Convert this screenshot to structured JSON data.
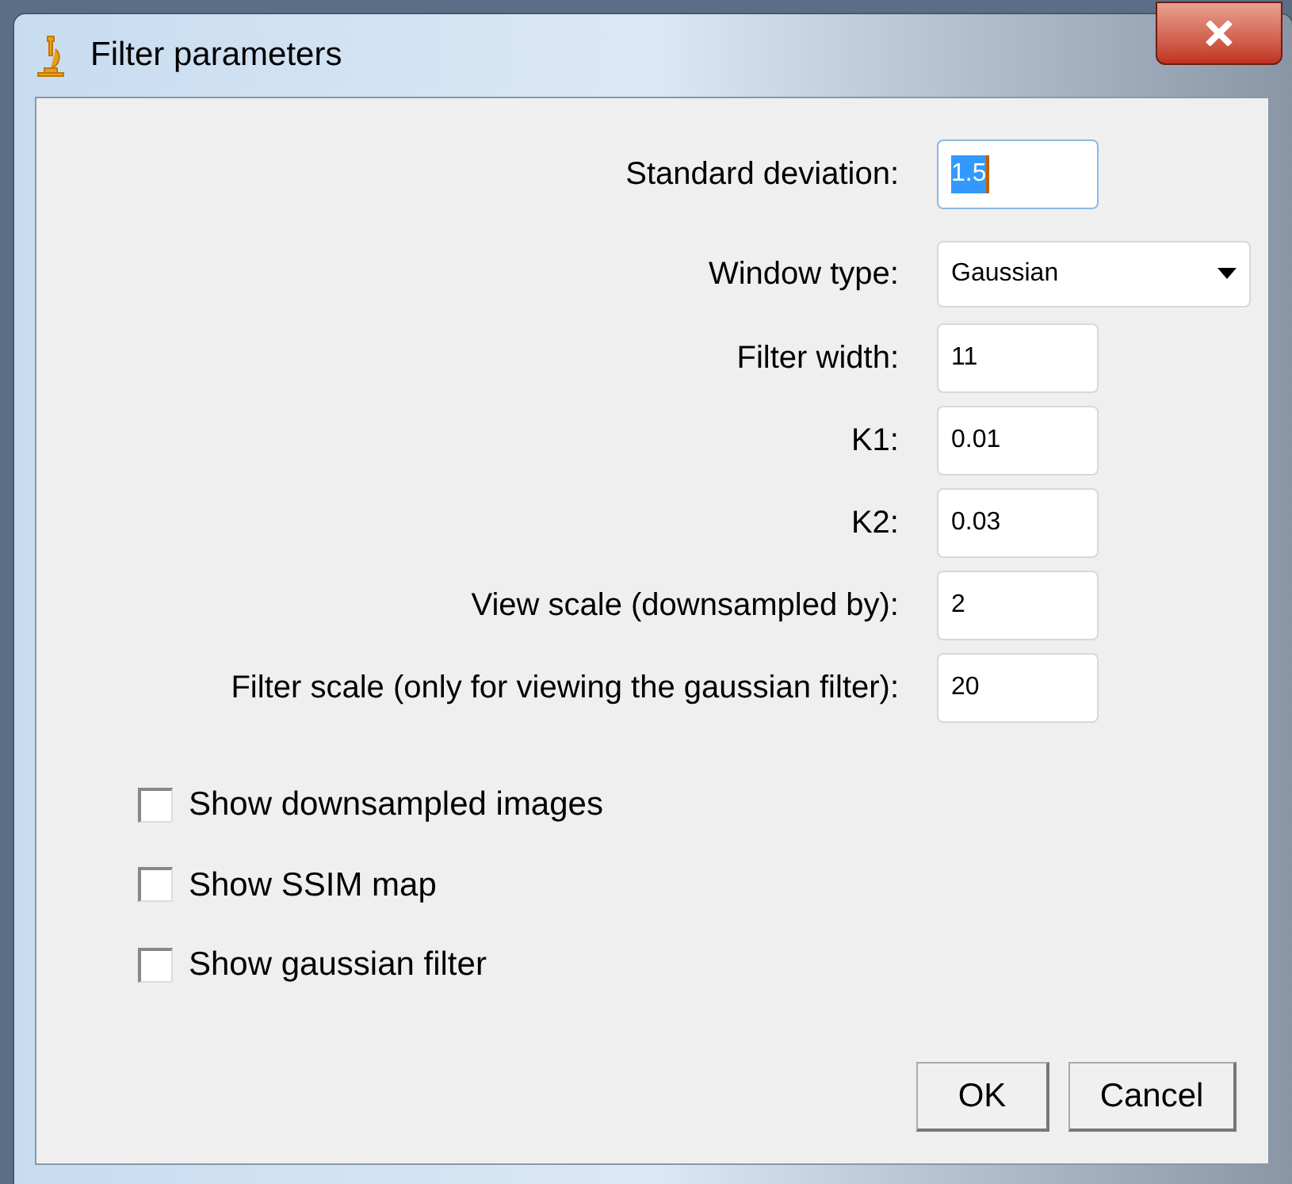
{
  "window": {
    "title": "Filter parameters"
  },
  "fields": [
    {
      "kind": "text",
      "label": "Standard deviation:",
      "value": "1.5",
      "highlighted": true
    },
    {
      "kind": "dropdown",
      "label": "Window type:",
      "value": "Gaussian",
      "highlighted": false
    },
    {
      "kind": "text",
      "label": "Filter width:",
      "value": "11",
      "highlighted": false
    },
    {
      "kind": "text",
      "label": "K1:",
      "value": "0.01",
      "highlighted": false
    },
    {
      "kind": "text",
      "label": "K2:",
      "value": "0.03",
      "highlighted": false
    },
    {
      "kind": "text",
      "label": "View scale (downsampled by):",
      "value": "2",
      "highlighted": false
    },
    {
      "kind": "text",
      "label": "Filter scale (only for viewing the gaussian filter):",
      "value": "20",
      "highlighted": false
    }
  ],
  "checkboxes": [
    {
      "label": "Show downsampled images",
      "checked": false
    },
    {
      "label": "Show SSIM map",
      "checked": false
    },
    {
      "label": "Show gaussian filter",
      "checked": false
    }
  ],
  "buttons": [
    "OK",
    "Cancel"
  ]
}
